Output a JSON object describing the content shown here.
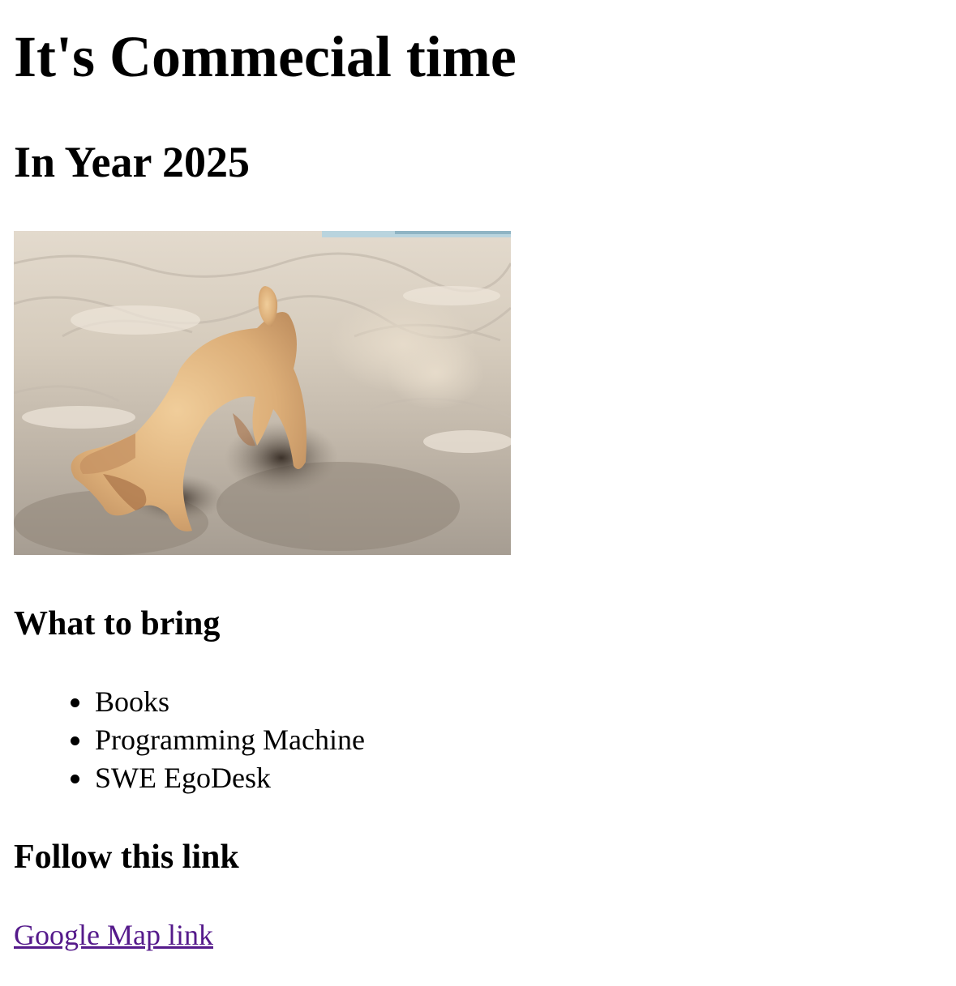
{
  "page": {
    "title": "It's Commecial time",
    "subtitle": "In Year 2025"
  },
  "photo": {
    "alt": "puppy digging in sand on a beach",
    "icon": "dog-digging-photo"
  },
  "bring": {
    "heading": "What to bring",
    "items": [
      "Books",
      "Programming Machine",
      "SWE EgoDesk"
    ]
  },
  "follow": {
    "heading": "Follow this link",
    "link_label": "Google Map link"
  },
  "colors": {
    "visited_link": "#551a8b",
    "text": "#000000",
    "background": "#ffffff"
  }
}
